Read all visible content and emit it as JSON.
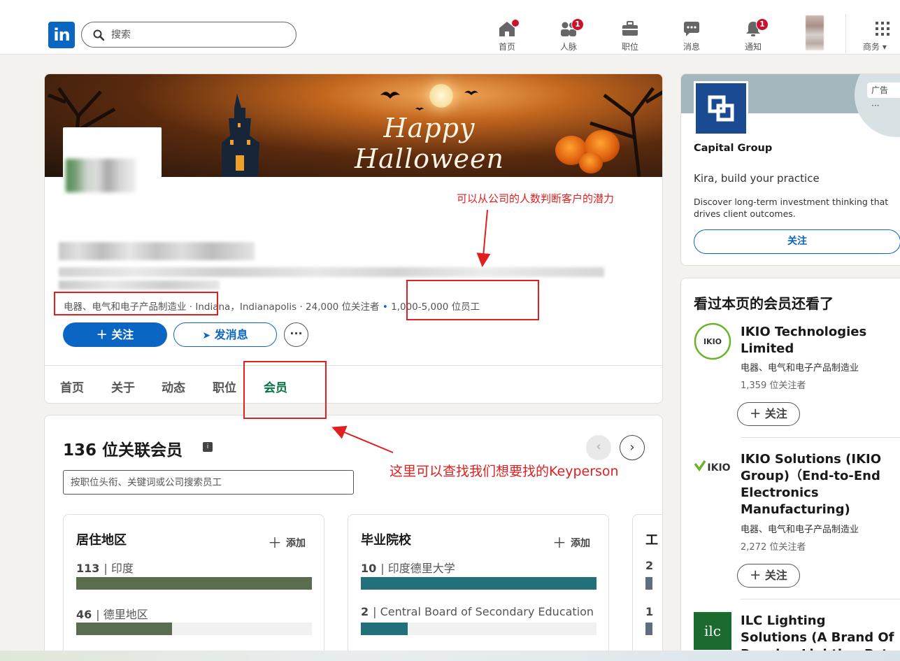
{
  "nav": {
    "logo_text": "in",
    "search_placeholder": "搜索",
    "items": [
      {
        "label": "首页",
        "badge": "",
        "icon": "home-icon"
      },
      {
        "label": "人脉",
        "badge": "1",
        "icon": "people-icon"
      },
      {
        "label": "职位",
        "badge": "",
        "icon": "briefcase-icon"
      },
      {
        "label": "消息",
        "badge": "",
        "icon": "message-icon"
      },
      {
        "label": "通知",
        "badge": "1",
        "icon": "bell-icon"
      },
      {
        "label": "商务",
        "badge": "",
        "icon": "grid-icon"
      }
    ]
  },
  "banner": {
    "title": "Happy Halloween"
  },
  "company": {
    "meta_industry": "电器、电气和电子产品制造业",
    "meta_location": " · Indiana，Indianapolis · 24,000 位关注者 ",
    "meta_dot": "•",
    "meta_size": " 1,000-5,000 位员工",
    "follow_label": "＋ 关注",
    "message_label": "发消息",
    "more_label": "···"
  },
  "tabs": [
    {
      "label": "首页"
    },
    {
      "label": "关于"
    },
    {
      "label": "动态"
    },
    {
      "label": "职位"
    },
    {
      "label": "会员",
      "active": true
    }
  ],
  "members": {
    "title": "136 位关联会员",
    "search_placeholder": "按职位头衔、关键词或公司搜索员工",
    "prev": "‹",
    "next": "›",
    "add_label": "添加",
    "stats": [
      {
        "title": "居住地区",
        "rows": [
          {
            "count": "113",
            "label": "印度",
            "fraction": 1.0
          },
          {
            "count": "46",
            "label": "德里地区",
            "fraction": 0.407
          }
        ],
        "color": "#5a6e4f"
      },
      {
        "title": "毕业院校",
        "rows": [
          {
            "count": "10",
            "label": "印度德里大学",
            "fraction": 1.0
          },
          {
            "count": "2",
            "label": "Central Board of Secondary Education",
            "fraction": 0.2
          }
        ],
        "color": "#22707a"
      }
    ],
    "third_card": {
      "title_fragment": "工",
      "row1": "2",
      "row2": "1"
    }
  },
  "ad": {
    "label": "广告 ···",
    "company": "Capital Group",
    "headline": "Kira, build your practice",
    "description": "Discover long-term investment thinking that drives client outcomes.",
    "follow_label": "关注"
  },
  "also_viewed": {
    "title": "看过本页的会员还看了",
    "follow_label": "＋ 关注",
    "companies": [
      {
        "name": "IKIO Technologies Limited",
        "industry": "电器、电气和电子产品制造业",
        "followers": "1,359 位关注者"
      },
      {
        "name": "IKIO Solutions (IKIO Group)（End-to-End Electronics Manufacturing)",
        "industry": "电器、电气和电子产品制造业",
        "followers": "2,272 位关注者"
      },
      {
        "name": "ILC Lighting Solutions (A Brand Of Royalux Lighting Pvt Ltd)",
        "industry": "",
        "followers": ""
      }
    ],
    "logo_texts": [
      "IKIO",
      "IKIO",
      "ilc"
    ]
  },
  "annotations": {
    "size_note": "可以从公司的人数判断客户的潜力",
    "member_note": "这里可以查找我们想要找的Keyperson"
  }
}
